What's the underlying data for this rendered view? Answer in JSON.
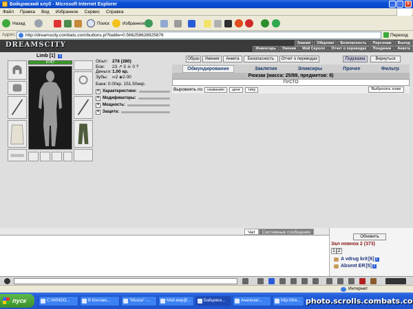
{
  "window": {
    "title": "Бойцовский клуб - Microsoft Internet Explorer"
  },
  "menu": [
    "Файл",
    "Правка",
    "Вид",
    "Избранное",
    "Сервис",
    "Справка"
  ],
  "toolbar": {
    "back": "Назад",
    "search": "Поиск",
    "favorites": "Избранное"
  },
  "address": {
    "label": "Адрес:",
    "url": "http://dreamscity.combats.com/buttons.pl?battle=0.566258628925876",
    "go": "Переход"
  },
  "game": {
    "logo": "DREAMSCITY",
    "nav_top": [
      "Знания",
      "Общение",
      "Безопасность",
      "Персонаж",
      "Выход"
    ],
    "nav_bottom": [
      "Инвентарь",
      "Умения",
      "Мой Скролл",
      "Отчет о переводах",
      "Поединки",
      "Анкета"
    ]
  },
  "character": {
    "name": "Limb",
    "level": "[1]",
    "hp": "87/87",
    "stats": [
      {
        "label": "Опыт:",
        "value": "278 (280)"
      },
      {
        "label": "Бои:",
        "value": "23 ↗ 3 ☠ 0 ?"
      },
      {
        "label": "Деньги:",
        "value": "1.00 кр."
      },
      {
        "label": "Зубы:",
        "value": "∞2 ◈2.00"
      }
    ],
    "bank": "Банк: 0.00кр. 151.50екр.",
    "sections": [
      "Характеристики:",
      "Модификаторы:",
      "Мощность:",
      "Защита:"
    ]
  },
  "inventory": {
    "buttons_top": [
      "Образ",
      "Умения",
      "Анкета",
      "Безопасность",
      "Отчет о переводах",
      "Подсказка",
      "Вернуться"
    ],
    "tabs": [
      "Обмундирование",
      "Заклятия",
      "Эликсиры",
      "Прочее",
      "Фильтр"
    ],
    "backpack": "Рюкзак (масса: 25/89, предметов: 8)",
    "empty": "ПУСТО",
    "sort_label": "Выровнять по",
    "sort_buttons": [
      "названию",
      "цене",
      "типу"
    ],
    "drop_all": "Выбросить хлам"
  },
  "chat": {
    "tabs": [
      "Чат",
      "Системные сообщения"
    ],
    "refresh": "Обновить",
    "room": "Зал новноа 2 (373)",
    "pages": [
      "1",
      "2"
    ],
    "players": [
      {
        "name": "A vdrug krit",
        "level": "[6]"
      },
      {
        "name": "Absent ER",
        "level": "[5]"
      }
    ]
  },
  "statusbar": {
    "zone": "Интернет"
  },
  "taskbar": {
    "start": "пуск",
    "tasks": [
      "C:\\WINDO...",
      "В Контакс...",
      "\"Muoze\" -...",
      "Мой мир@...",
      "Бойцовск...",
      "Анализат...",
      "http://dre..."
    ]
  },
  "watermark": "photo.scrolls.combats.com"
}
